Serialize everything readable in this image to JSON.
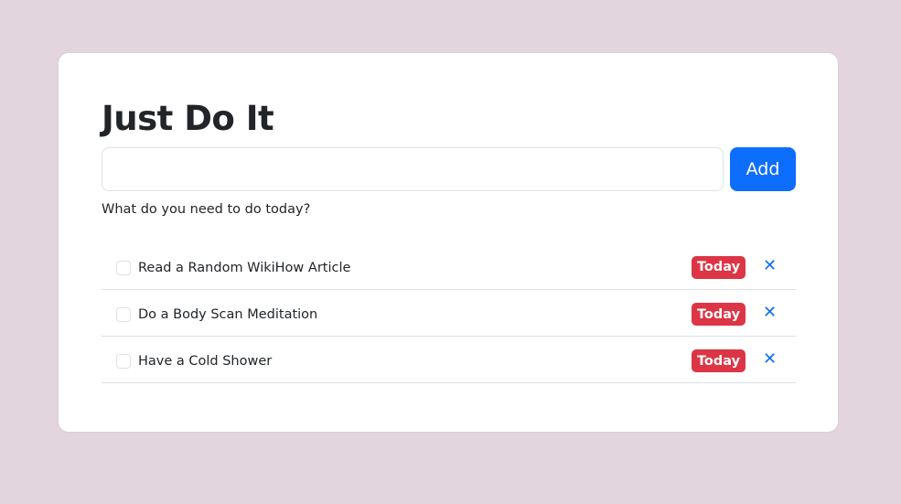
{
  "title": "Just Do It",
  "input": {
    "value": "",
    "placeholder": ""
  },
  "add_label": "Add",
  "help_text": "What do you need to do today?",
  "todos": [
    {
      "text": "Read a Random WikiHow Article",
      "badge": "Today",
      "checked": false
    },
    {
      "text": "Do a Body Scan Meditation",
      "badge": "Today",
      "checked": false
    },
    {
      "text": "Have a Cold Shower",
      "badge": "Today",
      "checked": false
    }
  ],
  "delete_glyph": "✕",
  "colors": {
    "background": "#e2d5de",
    "primary": "#0d6efd",
    "danger": "#dc3545"
  }
}
